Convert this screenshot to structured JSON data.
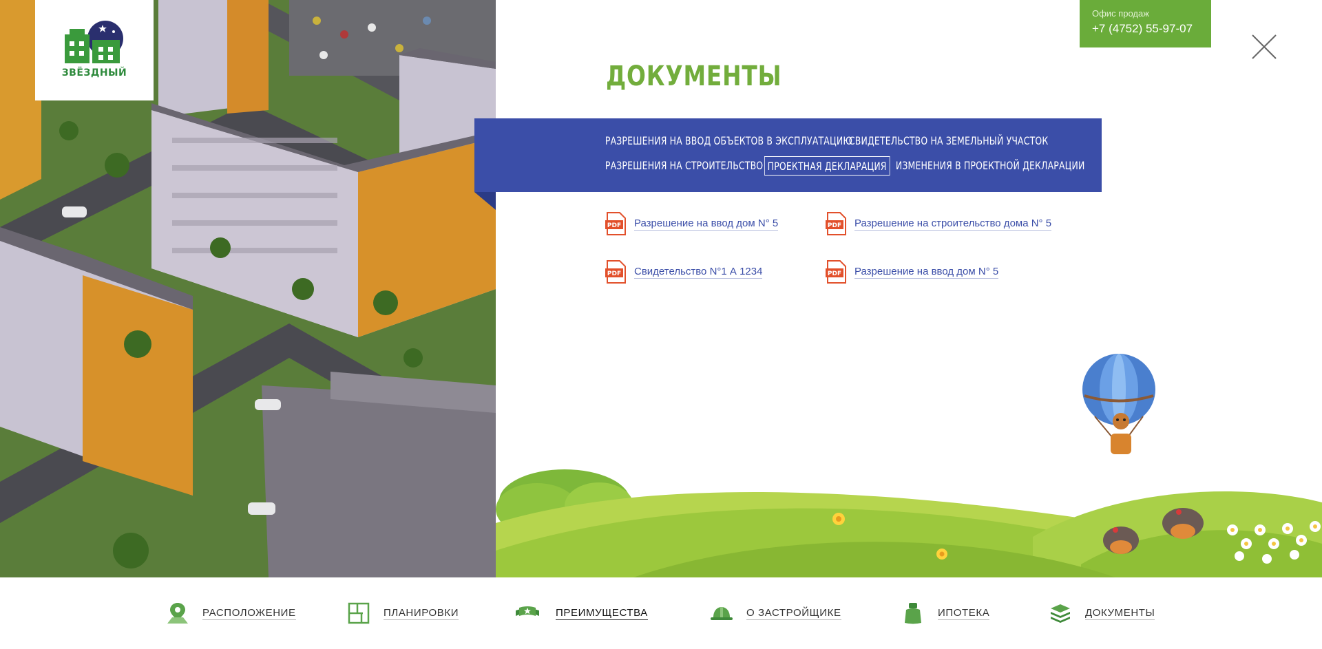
{
  "brand": {
    "name": "ЗВЁЗДНЫЙ"
  },
  "office": {
    "label": "Офис продаж",
    "phone": "+7 (4752) 55-97-07"
  },
  "page": {
    "title": "ДОКУМЕНТЫ"
  },
  "tabs": [
    {
      "label": "РАЗРЕШЕНИЯ НА ВВОД ОБЪЕКТОВ В ЭКСПЛУАТАЦИЮ",
      "active": false
    },
    {
      "label": "СВИДЕТЕЛЬСТВО НА ЗЕМЕЛЬНЫЙ УЧАСТОК",
      "active": false
    },
    {
      "label": "РАЗРЕШЕНИЯ НА СТРОИТЕЛЬСТВО",
      "active": false
    },
    {
      "label": "ПРОЕКТНАЯ ДЕКЛАРАЦИЯ",
      "active": true
    },
    {
      "label": "ИЗМЕНЕНИЯ В ПРОЕКТНОЙ ДЕКЛАРАЦИИ",
      "active": false
    }
  ],
  "documents": [
    {
      "label": "Разрешение на ввод дом N° 5",
      "icon": "pdf-icon"
    },
    {
      "label": "Разрешение на строительство дома N° 5",
      "icon": "pdf-icon"
    },
    {
      "label": "Свидетельство N°1 А 1234",
      "icon": "pdf-icon"
    },
    {
      "label": "Разрешение на ввод дом N° 5",
      "icon": "pdf-icon"
    }
  ],
  "nav": [
    {
      "label": "РАСПОЛОЖЕНИЕ",
      "icon": "location-pin-icon",
      "active": false
    },
    {
      "label": "ПЛАНИРОВКИ",
      "icon": "floor-plan-icon",
      "active": false
    },
    {
      "label": "ПРЕИМУЩЕСТВА",
      "icon": "ribbon-star-icon",
      "active": true
    },
    {
      "label": "О ЗАСТРОЙЩИКЕ",
      "icon": "hard-hat-icon",
      "active": false
    },
    {
      "label": "ИПОТЕКА",
      "icon": "money-bag-icon",
      "active": false
    },
    {
      "label": "ДОКУМЕНТЫ",
      "icon": "document-stack-icon",
      "active": false
    }
  ],
  "colors": {
    "accent_green": "#72ad3c",
    "band_blue": "#3b4ea8",
    "office_green": "#6aac3a",
    "link_blue": "#3b4ea8",
    "pdf_red": "#e2502b"
  }
}
